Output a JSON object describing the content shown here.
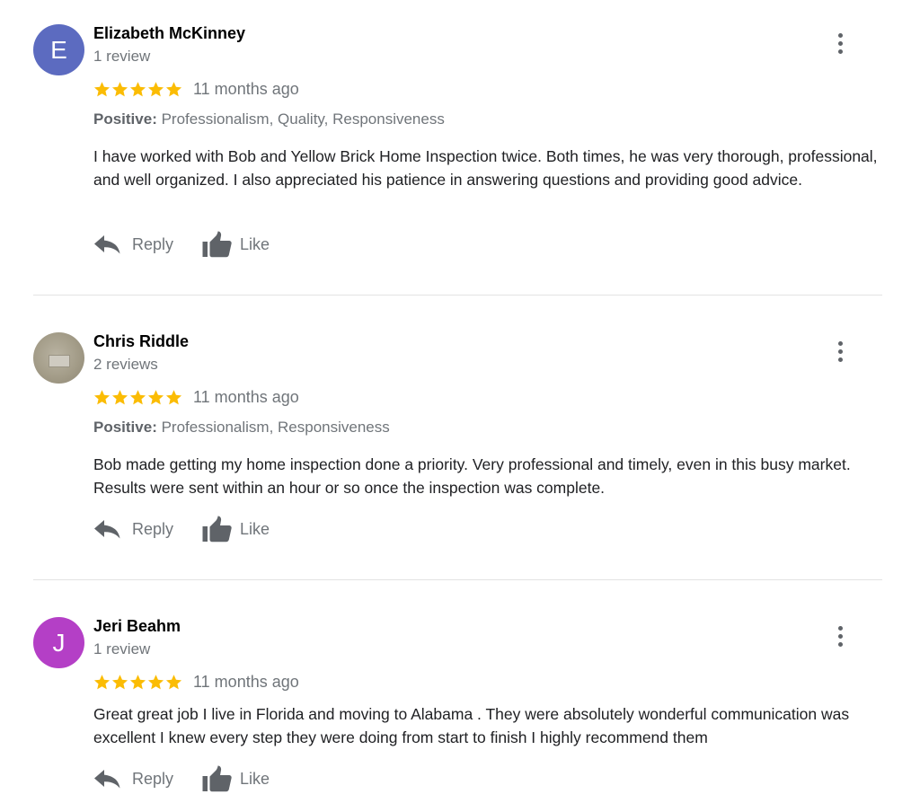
{
  "colors": {
    "star": "#fbbc04",
    "secondary_text": "#70757a",
    "divider": "#e3e3e3"
  },
  "icons": {
    "star": "star-icon",
    "reply": "reply-icon",
    "like": "thumbs-up-icon",
    "more": "more-vert-icon"
  },
  "reviews": [
    {
      "avatar_letter": "E",
      "avatar_color": "#5c6bc0",
      "name": "Elizabeth McKinney",
      "review_count": "1 review",
      "stars": 5,
      "time": "11 months ago",
      "positive_label": "Positive:",
      "positive_items": " Professionalism, Quality, Responsiveness",
      "text": "I have worked with Bob and Yellow Brick Home Inspection twice. Both times, he was very thorough, professional, and well organized. I also appreciated his patience in answering questions and providing good advice.",
      "reply_label": "Reply",
      "like_label": "Like"
    },
    {
      "avatar_letter": "",
      "avatar_color": "#a39c88",
      "name": "Chris Riddle",
      "review_count": "2 reviews",
      "stars": 5,
      "time": "11 months ago",
      "positive_label": "Positive:",
      "positive_items": " Professionalism, Responsiveness",
      "text": "Bob made getting my home inspection done a priority. Very professional and timely, even in this busy market. Results were sent within an hour or so once the inspection was complete.",
      "reply_label": "Reply",
      "like_label": "Like"
    },
    {
      "avatar_letter": "J",
      "avatar_color": "#b43fc6",
      "name": "Jeri Beahm",
      "review_count": "1 review",
      "stars": 5,
      "time": "11 months ago",
      "text": "Great great job I live in Florida and moving to Alabama . They were absolutely wonderful communication was excellent I knew every step they were doing from start to finish I highly recommend them",
      "reply_label": "Reply",
      "like_label": "Like"
    }
  ]
}
